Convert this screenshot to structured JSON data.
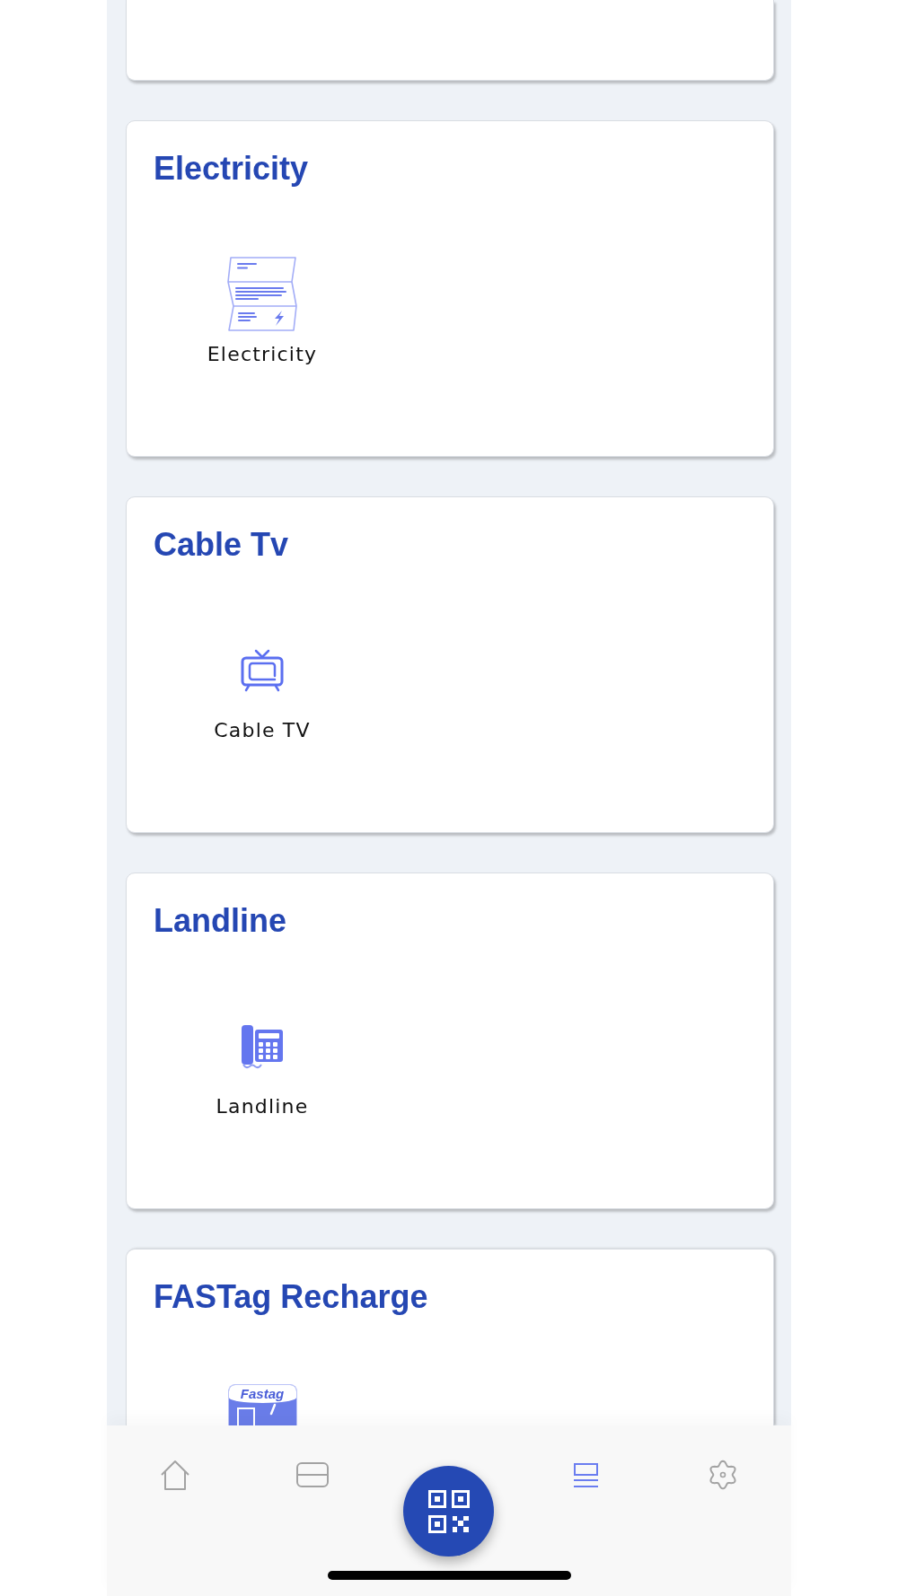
{
  "cards": [
    {
      "title": "Electricity",
      "items": [
        {
          "kind": "bill",
          "label": "Electricity"
        }
      ]
    },
    {
      "title": "Cable Tv",
      "items": [
        {
          "kind": "tv",
          "label": "Cable TV"
        }
      ]
    },
    {
      "title": "Landline",
      "items": [
        {
          "kind": "phone",
          "label": "Landline"
        }
      ]
    },
    {
      "title": "FASTag Recharge",
      "items": [
        {
          "kind": "tag",
          "logo_text": "Fastag"
        }
      ]
    }
  ],
  "bottom_nav": {
    "tabs": [
      {
        "kind": "home",
        "selected": false
      },
      {
        "kind": "card",
        "selected": false
      },
      {
        "kind": "list",
        "selected": true
      },
      {
        "kind": "settings",
        "selected": false
      }
    ]
  }
}
